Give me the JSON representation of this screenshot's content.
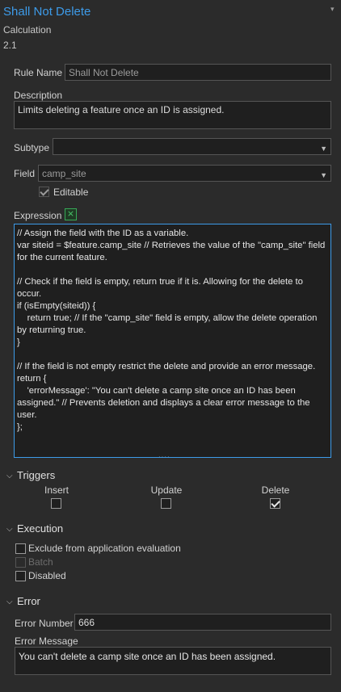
{
  "header": {
    "title": "Shall Not Delete",
    "type": "Calculation",
    "version": "2.1"
  },
  "rule_name": {
    "label": "Rule Name",
    "placeholder": "Shall Not Delete"
  },
  "description": {
    "label": "Description",
    "value": "Limits deleting a feature once an ID is assigned."
  },
  "subtype": {
    "label": "Subtype",
    "value": ""
  },
  "field": {
    "label": "Field",
    "value": "camp_site",
    "editable_label": "Editable",
    "editable_checked": true
  },
  "expression": {
    "label": "Expression",
    "code": "// Assign the field with the ID as a variable.\nvar siteid = $feature.camp_site // Retrieves the value of the \"camp_site\" field for the current feature.\n\n// Check if the field is empty, return true if it is. Allowing for the delete to occur.\nif (isEmpty(siteid)) {\n    return true; // If the \"camp_site\" field is empty, allow the delete operation by returning true.\n}\n\n// If the field is not empty restrict the delete and provide an error message.\nreturn {\n    'errorMessage': \"You can't delete a camp site once an ID has been assigned.\" // Prevents deletion and displays a clear error message to the user.\n};"
  },
  "triggers": {
    "title": "Triggers",
    "insert": {
      "label": "Insert",
      "checked": false
    },
    "update": {
      "label": "Update",
      "checked": false
    },
    "delete": {
      "label": "Delete",
      "checked": true
    }
  },
  "execution": {
    "title": "Execution",
    "exclude_label": "Exclude from application evaluation",
    "batch_label": "Batch",
    "disabled_label": "Disabled"
  },
  "error": {
    "title": "Error",
    "number_label": "Error Number",
    "number_value": "666",
    "message_label": "Error Message",
    "message_value": "You can't delete a camp site once an ID has been assigned."
  },
  "colors": {
    "accent": "#3d9be9",
    "background": "#2b2b2b",
    "input_bg": "#1f1f1f"
  }
}
